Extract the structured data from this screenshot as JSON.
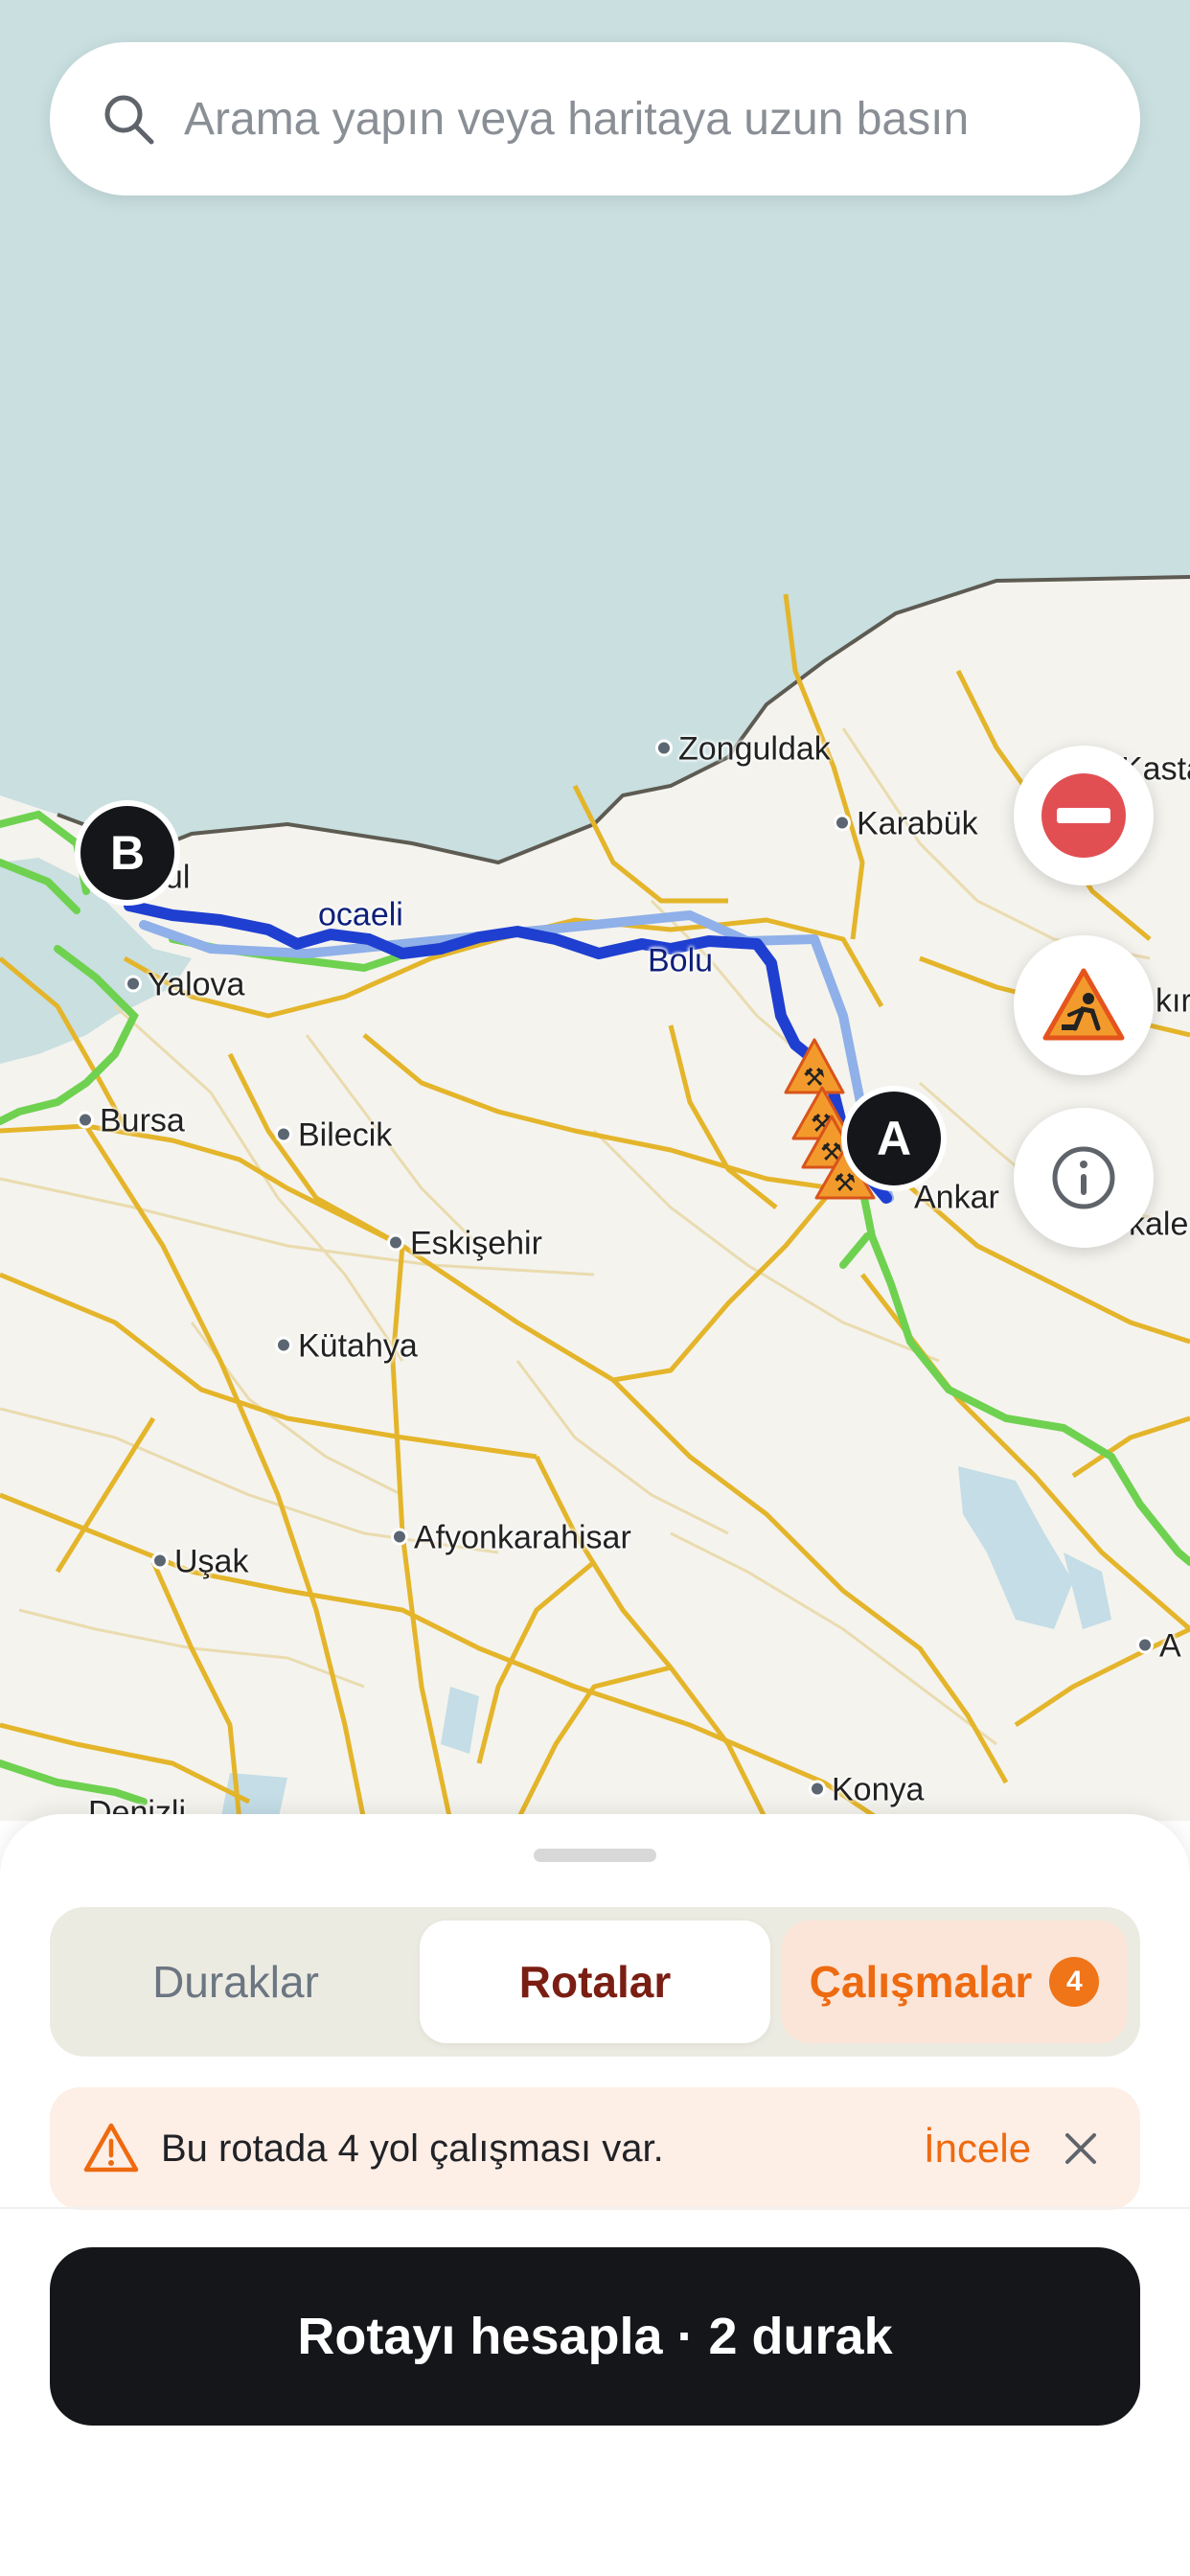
{
  "search": {
    "placeholder": "Arama yapın veya haritaya uzun basın"
  },
  "map": {
    "cities": [
      {
        "name": "Zonguldak"
      },
      {
        "name": "Karabük"
      },
      {
        "name": "Kasta"
      },
      {
        "name": "bul"
      },
      {
        "name": "Yalova"
      },
      {
        "name": "Bursa"
      },
      {
        "name": "Bilecik"
      },
      {
        "name": "Eskişehir"
      },
      {
        "name": "Kütahya"
      },
      {
        "name": "Afyonkarahisar"
      },
      {
        "name": "Uşak"
      },
      {
        "name": "Konya"
      },
      {
        "name": "Ankar"
      },
      {
        "name": "kale"
      },
      {
        "name": "kırı"
      },
      {
        "name": "A"
      },
      {
        "name": "Denizli"
      },
      {
        "name": "Bolu"
      },
      {
        "name": "ocaeli"
      }
    ],
    "markers": {
      "start": "A",
      "end": "B"
    },
    "roadwork_count": 4
  },
  "map_controls": [
    "no-entry-icon",
    "roadwork-icon",
    "info-icon"
  ],
  "sheet": {
    "tabs": [
      {
        "label": "Duraklar",
        "active": false
      },
      {
        "label": "Rotalar",
        "active": true
      },
      {
        "label": "Çalışmalar",
        "badge": "4",
        "active": false
      }
    ],
    "alert": {
      "text": "Bu rotada 4 yol çalışması var.",
      "action": "İncele"
    },
    "primary_button": "Rotayı hesapla · 2 durak"
  },
  "colors": {
    "sea": "#c9dfe0",
    "land": "#f4f3ee",
    "route": "#1f3fd0",
    "route_alt": "#8fb0e8",
    "highway": "#e6b523",
    "traffic": "#6fd150",
    "accent": "#ee6a10",
    "dark": "#14161a"
  }
}
